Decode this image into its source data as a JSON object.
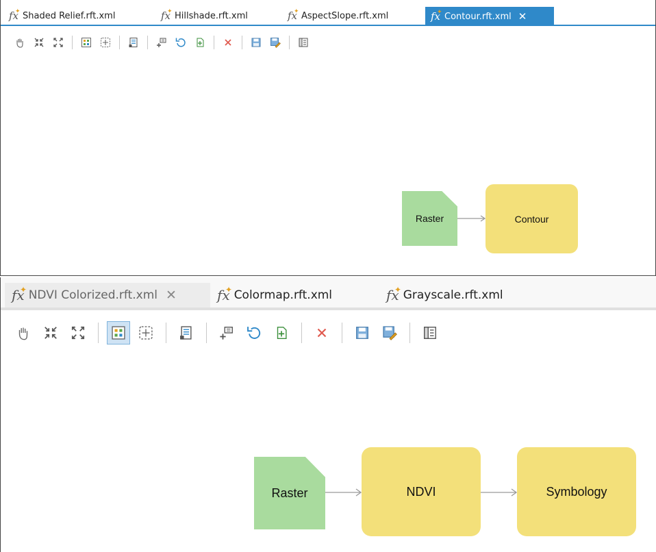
{
  "top_editor": {
    "tabs": [
      {
        "label": "Shaded Relief.rft.xml",
        "active": false
      },
      {
        "label": "Hillshade.rft.xml",
        "active": false
      },
      {
        "label": "AspectSlope.rft.xml",
        "active": false
      },
      {
        "label": "Contour.rft.xml",
        "active": true
      }
    ],
    "toolbar": [
      "pan-icon",
      "fit-to-window-icon",
      "full-extent-icon",
      "auto-layout-icon",
      "fixed-extent-icon",
      "properties-icon",
      "add-function-icon",
      "undo-icon",
      "new-template-icon",
      "delete-icon",
      "save-icon",
      "save-as-icon",
      "template-properties-icon"
    ],
    "nodes": {
      "raster": "Raster",
      "function": "Contour"
    }
  },
  "bottom_editor": {
    "tabs": [
      {
        "label": "NDVI Colorized.rft.xml",
        "active": true
      },
      {
        "label": "Colormap.rft.xml",
        "active": false
      },
      {
        "label": "Grayscale.rft.xml",
        "active": false
      }
    ],
    "toolbar": [
      "pan-icon",
      "fit-to-window-icon",
      "full-extent-icon",
      "auto-layout-icon",
      "fixed-extent-icon",
      "properties-icon",
      "add-function-icon",
      "undo-icon",
      "new-template-icon",
      "delete-icon",
      "save-icon",
      "save-as-icon",
      "template-properties-icon"
    ],
    "pressed_tool": "auto-layout-icon",
    "nodes": {
      "raster": "Raster",
      "function1": "NDVI",
      "function2": "Symbology"
    }
  },
  "colors": {
    "accent": "#2f89c9",
    "raster_node": "#a9db9e",
    "function_node": "#f3e07a",
    "delete": "#e05a4f"
  }
}
